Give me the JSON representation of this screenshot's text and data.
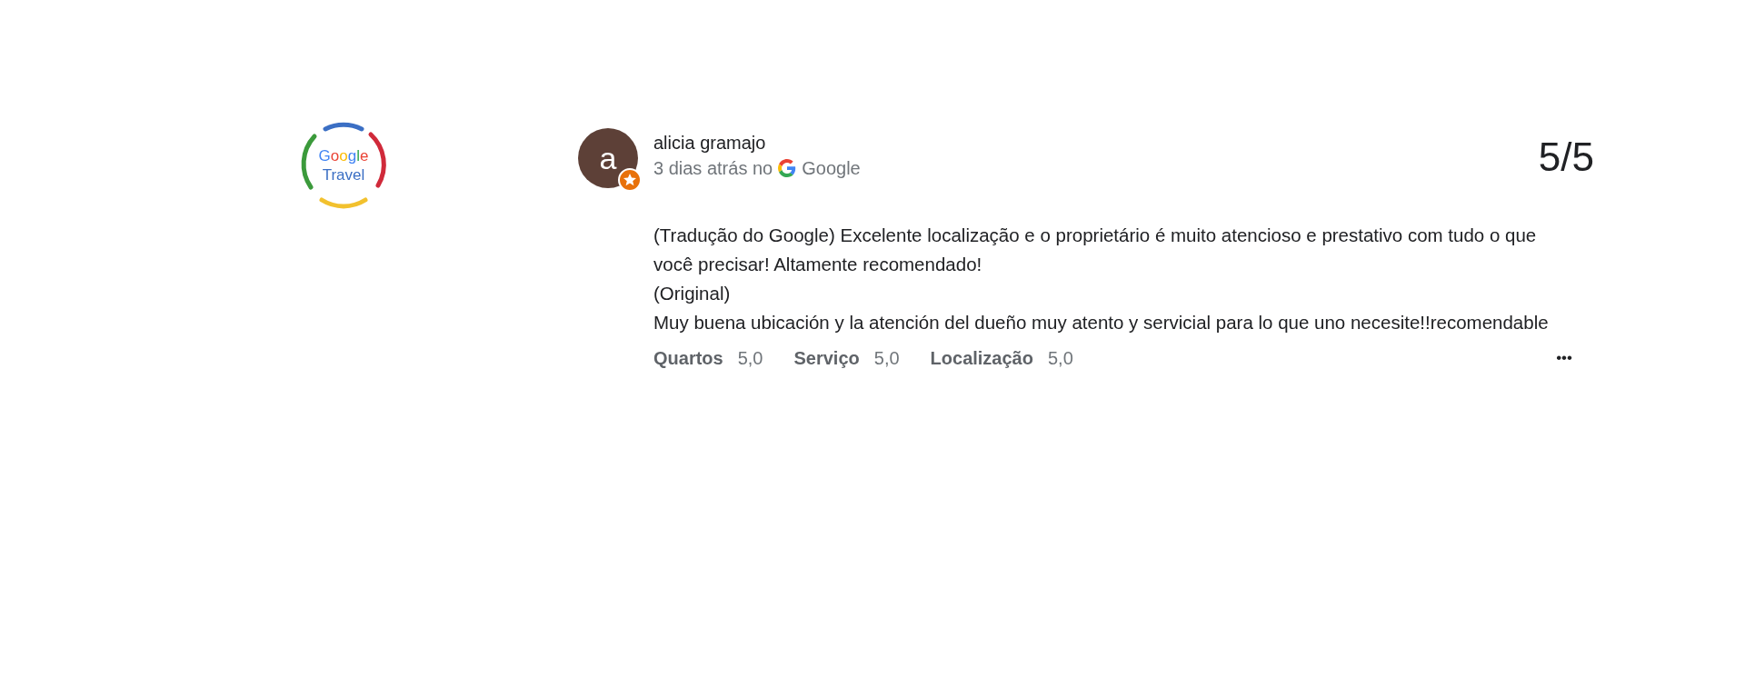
{
  "logo": {
    "line_1": "Google",
    "line_2": "Travel"
  },
  "review": {
    "author": "alicia gramajo",
    "avatar_letter": "a",
    "local_guide": true,
    "date": "3 dias atrás no",
    "source": "Google",
    "score": "5/5",
    "paragraphs": [
      "(Tradução do Google) Excelente localização e o proprietário é muito atencioso e prestativo com tudo o que você precisar! Altamente recomendado!",
      "(Original)",
      "Muy buena ubicación y la atención del dueño muy atento y servicial para lo que uno necesite!!recomendable"
    ],
    "ratings": [
      {
        "label": "Quartos",
        "value": "5,0"
      },
      {
        "label": "Serviço",
        "value": "5,0"
      },
      {
        "label": "Localização",
        "value": "5,0"
      }
    ],
    "more": "•••"
  }
}
